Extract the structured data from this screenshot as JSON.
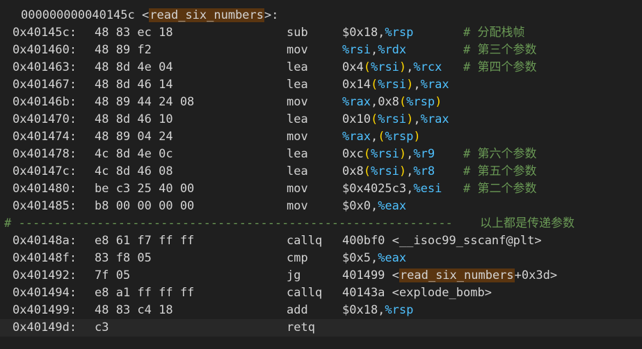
{
  "header": {
    "address": "000000000040145c",
    "open": " <",
    "symbol": "read_six_numbers",
    "close": ">:"
  },
  "lines": [
    {
      "addr": "0x40145c:",
      "bytes": "48 83 ec 18",
      "mnem": "sub",
      "ops": "$0x18,%rsp",
      "comment": "# 分配栈帧"
    },
    {
      "addr": "0x401460:",
      "bytes": "48 89 f2",
      "mnem": "mov",
      "ops": "%rsi,%rdx",
      "comment": "# 第三个参数"
    },
    {
      "addr": "0x401463:",
      "bytes": "48 8d 4e 04",
      "mnem": "lea",
      "ops": "0x4(%rsi),%rcx",
      "comment": "# 第四个参数"
    },
    {
      "addr": "0x401467:",
      "bytes": "48 8d 46 14",
      "mnem": "lea",
      "ops": "0x14(%rsi),%rax",
      "comment": ""
    },
    {
      "addr": "0x40146b:",
      "bytes": "48 89 44 24 08",
      "mnem": "mov",
      "ops": "%rax,0x8(%rsp)",
      "comment": ""
    },
    {
      "addr": "0x401470:",
      "bytes": "48 8d 46 10",
      "mnem": "lea",
      "ops": "0x10(%rsi),%rax",
      "comment": ""
    },
    {
      "addr": "0x401474:",
      "bytes": "48 89 04 24",
      "mnem": "mov",
      "ops": "%rax,(%rsp)",
      "comment": ""
    },
    {
      "addr": "0x401478:",
      "bytes": "4c 8d 4e 0c",
      "mnem": "lea",
      "ops": "0xc(%rsi),%r9",
      "comment": "# 第六个参数"
    },
    {
      "addr": "0x40147c:",
      "bytes": "4c 8d 46 08",
      "mnem": "lea",
      "ops": "0x8(%rsi),%r8",
      "comment": "# 第五个参数"
    },
    {
      "addr": "0x401480:",
      "bytes": "be c3 25 40 00",
      "mnem": "mov",
      "ops": "$0x4025c3,%esi",
      "comment": "# 第二个参数"
    },
    {
      "addr": "0x401485:",
      "bytes": "b8 00 00 00 00",
      "mnem": "mov",
      "ops": "$0x0,%eax",
      "comment": ""
    }
  ],
  "separator": {
    "dashes": "# -------------------------------------------------------------",
    "note": "以上都是传递参数"
  },
  "lines2": [
    {
      "addr": "0x40148a:",
      "bytes": "e8 61 f7 ff ff",
      "mnem": "callq",
      "ops_pre": "400bf0 <__isoc99_sscanf@plt>"
    },
    {
      "addr": "0x40148f:",
      "bytes": "83 f8 05",
      "mnem": "cmp",
      "ops_pre": "$0x5,%eax"
    },
    {
      "addr": "0x401492:",
      "bytes": "7f 05",
      "mnem": "jg",
      "ops_pre": "401499 <",
      "symbol": "read_six_numbers",
      "ops_post": "+0x3d>"
    },
    {
      "addr": "0x401494:",
      "bytes": "e8 a1 ff ff ff",
      "mnem": "callq",
      "ops_pre": "40143a <explode_bomb>"
    },
    {
      "addr": "0x401499:",
      "bytes": "48 83 c4 18",
      "mnem": "add",
      "ops_pre": "$0x18,%rsp"
    },
    {
      "addr": "0x40149d:",
      "bytes": "c3",
      "mnem": "retq",
      "ops_pre": ""
    }
  ],
  "colors": {
    "background": "#1f1f1f",
    "register": "#4fc1ff",
    "parenthesis": "#ffd700",
    "comment": "#6a9955",
    "highlight": "#5a3510"
  }
}
